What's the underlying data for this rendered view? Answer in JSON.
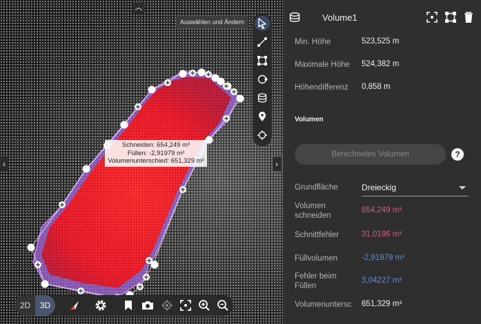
{
  "viewport": {
    "tooltip": "Auswählen und Ändern",
    "volume_label": {
      "cut": "Schneiden: 654,249 m³",
      "fill": "Füllen: -2,91979 m³",
      "difference": "Volumenunterschied: 651,329 m³"
    },
    "tools": [
      "cursor-icon",
      "line-measure-icon",
      "area-measure-icon",
      "circle-measure-icon",
      "volume-icon",
      "marker-pin-icon",
      "crosshair-icon"
    ],
    "bottom_bar": {
      "btn_2d": "2D",
      "btn_3d": "3D",
      "mode": "3D",
      "icons": [
        "compass-icon",
        "settings-icon",
        "bookmark-icon",
        "camera-icon",
        "locate-icon",
        "fit-view-icon",
        "zoom-in-icon",
        "zoom-out-icon"
      ]
    }
  },
  "panel": {
    "title": "Volume1",
    "header_icons": [
      "volume-icon",
      "focus-icon",
      "bounding-box-icon",
      "delete-icon"
    ],
    "rows": [
      {
        "label": "Min. Höhe",
        "value": "523,525 m"
      },
      {
        "label": "Maximale Höhe",
        "value": "524,382 m"
      },
      {
        "label": "Höhendifferenz",
        "value": "0,858 m"
      }
    ],
    "section_title": "Volumen",
    "calc_button": "Berechnetes Volumen",
    "help_button": "?",
    "base_label": "Grundfläche",
    "base_value": "Dreieckig",
    "results": [
      {
        "label": "Volumen schneiden",
        "value": "654,249 m³",
        "color": "#e0577f"
      },
      {
        "label": "Schnittfehler",
        "value": "31,0196 m³",
        "color": "#e0577f"
      },
      {
        "label": "Füllvolumen",
        "value": "-2,91979 m³",
        "color": "#5c8fd6"
      },
      {
        "label": "Fehler beim Füllen",
        "value": "3,04227 m³",
        "color": "#5c8fd6"
      },
      {
        "label": "Volumenuntersc",
        "value": "651,329 m³",
        "color": "#efefef"
      }
    ]
  },
  "colors": {
    "accent": "#4a5670",
    "cut": "#e0577f",
    "fill": "#5c8fd6",
    "volume_fill": "#ff2a2a",
    "volume_outline": "#b46ee6"
  }
}
